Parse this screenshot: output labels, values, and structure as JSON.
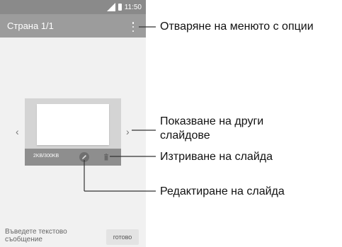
{
  "status_bar": {
    "time": "11:50",
    "icons": [
      "signal-icon",
      "battery-icon"
    ]
  },
  "app_bar": {
    "title": "Страна 1/1",
    "menu_icon": "overflow-menu-icon"
  },
  "slide": {
    "size": "2KB/300KB",
    "edit_icon": "pencil-icon",
    "delete_icon": "trash-icon"
  },
  "navigation": {
    "prev": "‹",
    "next": "›"
  },
  "compose": {
    "placeholder": "Въведете текстово съобщение",
    "done_label": "готово"
  },
  "callouts": {
    "menu": "Отваряне на менюто с опции",
    "other_slides_line1": "Показване на други",
    "other_slides_line2": "слайдове",
    "delete": "Изтриване на слайда",
    "edit": "Редактиране на слайда"
  },
  "colors": {
    "app_bar": "#9c9c9c",
    "status_bar": "#8a8a8a",
    "phone_bg": "#f1f1f1",
    "slide_footer": "#8e8e8e"
  }
}
